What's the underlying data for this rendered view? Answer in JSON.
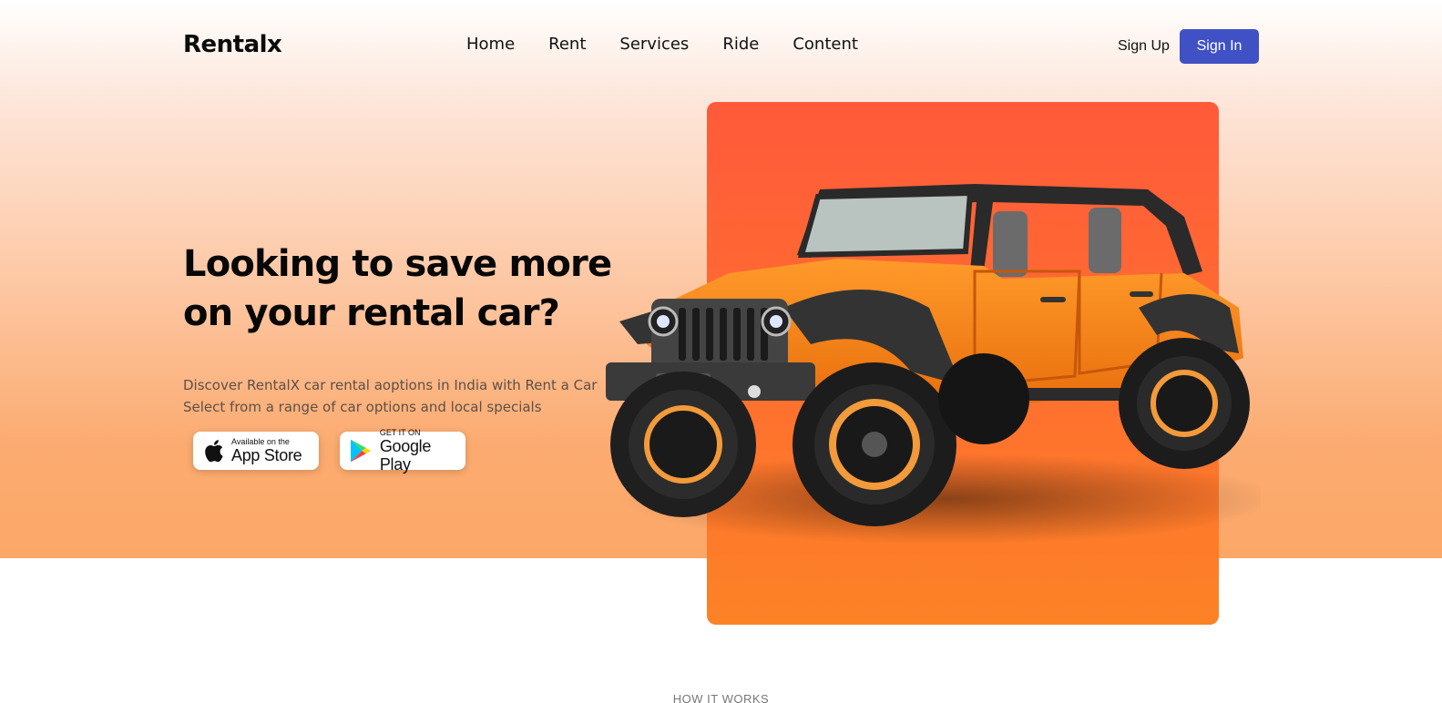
{
  "brand": {
    "logo": "Rentalx"
  },
  "nav": {
    "items": [
      "Home",
      "Rent",
      "Services",
      "Ride",
      "Content"
    ]
  },
  "auth": {
    "signup": "Sign Up",
    "signin": "Sign In"
  },
  "hero": {
    "headline": "Looking to save more on your rental car?",
    "sub_lines": [
      "Discover RentalX car rental aoptions in India with Rent a Car",
      "Select from a range of car options and local specials"
    ]
  },
  "stores": {
    "apple": {
      "small": "Available on the",
      "big": "App Store",
      "icon": "apple-icon"
    },
    "google": {
      "small": "GET IT ON",
      "big": "Google Play",
      "icon": "google-play-icon"
    }
  },
  "section": {
    "how_it_works": "HOW IT WORKS"
  },
  "colors": {
    "accent": "#3f51c5",
    "card_top": "#ff5a3a",
    "card_bottom": "#fd8226",
    "jeep_body": "#f7891c"
  }
}
